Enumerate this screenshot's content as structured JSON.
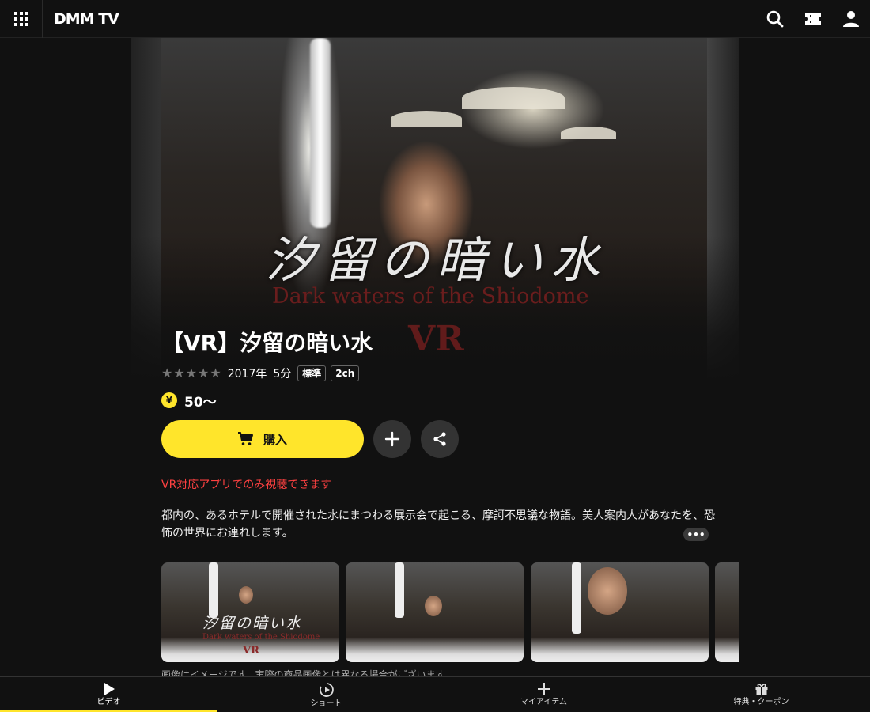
{
  "header": {
    "logo": "DMM TV",
    "menu_icon": "grid-menu-icon",
    "search_icon": "search-icon",
    "ticket_icon": "ticket-icon",
    "user_icon": "user-icon"
  },
  "hero": {
    "title_jp": "汐留の暗い水",
    "title_en": "Dark waters of the Shiodome",
    "badge": "VR"
  },
  "video": {
    "title": "【VR】汐留の暗い水",
    "rating_stars": 0,
    "year": "2017年",
    "duration": "5分",
    "tags": [
      "標準",
      "2ch"
    ],
    "price": "50〜",
    "yen_symbol": "¥",
    "buy_label": "購入",
    "warning": "VR対応アプリでのみ視聴できます",
    "description": "都内の、あるホテルで開催された水にまつわる展示会で起こる、摩訶不思議な物語。美人案内人があなたを、恐怖の世界にお連れします。",
    "more_label": "•••",
    "thumbnail_jp": "汐留の暗い水",
    "thumbnail_en": "Dark waters of the Shiodome",
    "thumbnail_vr": "VR",
    "image_note": "画像はイメージです。実際の商品画像とは異なる場合がございます。"
  },
  "bottom_nav": [
    {
      "label": "ビデオ",
      "icon": "play-icon",
      "active": true
    },
    {
      "label": "ショート",
      "icon": "short-play-icon",
      "active": false
    },
    {
      "label": "マイアイテム",
      "icon": "plus-icon",
      "active": false
    },
    {
      "label": "特典・クーポン",
      "icon": "gift-icon",
      "active": false
    }
  ],
  "colors": {
    "accent": "#ffe52b",
    "warning": "#ff4141",
    "background": "#111111"
  }
}
